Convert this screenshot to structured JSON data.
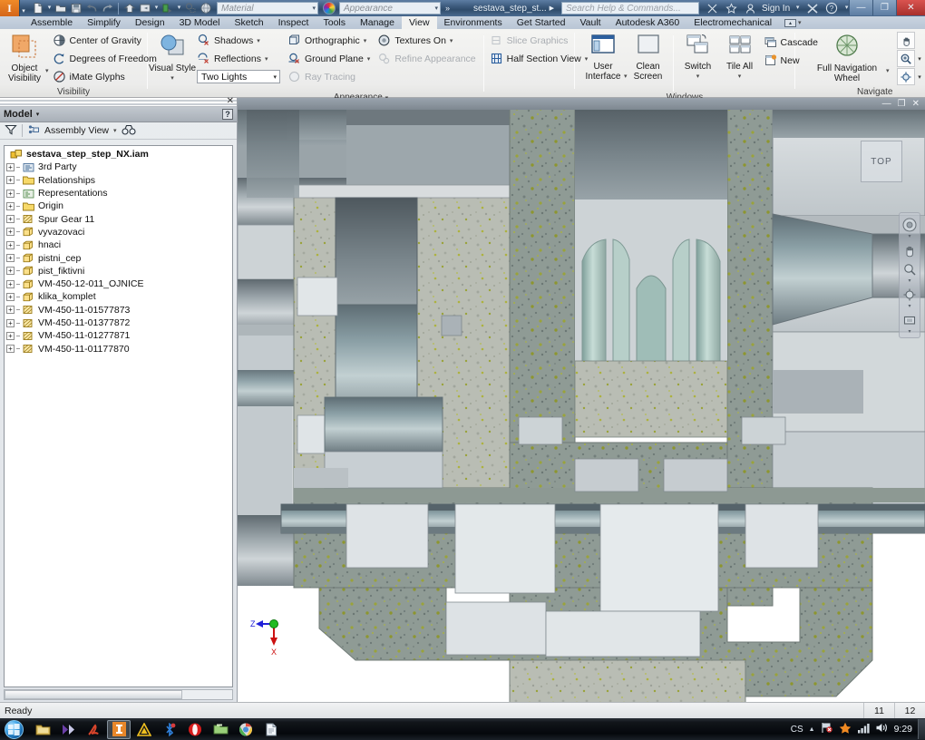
{
  "titlebar": {
    "app_icon": "inventor-logo-icon",
    "quick_access": [
      {
        "name": "new-document",
        "icon": "new-file-icon",
        "dropdown": true
      },
      {
        "name": "open-document",
        "icon": "open-folder-icon",
        "dropdown": false
      },
      {
        "name": "save-document",
        "icon": "save-disk-icon",
        "dropdown": false
      },
      {
        "name": "undo",
        "icon": "undo-arrow-icon",
        "dropdown": false
      },
      {
        "name": "redo",
        "icon": "redo-arrow-icon",
        "dropdown": false
      },
      {
        "name": "home",
        "icon": "home-icon",
        "dropdown": false
      },
      {
        "name": "return",
        "icon": "return-icon",
        "dropdown": true
      },
      {
        "name": "update",
        "icon": "update-icon",
        "dropdown": true
      },
      {
        "name": "select",
        "icon": "select-icon",
        "dropdown": false
      },
      {
        "name": "appearance-sphere",
        "icon": "sphere-icon",
        "dropdown": false
      }
    ],
    "material_value": "",
    "material_placeholder": "Material",
    "appearance_value": "",
    "appearance_placeholder": "Appearance",
    "overflow": "»",
    "document_tab": "sestava_step_st...",
    "search_placeholder": "Search Help & Commands...",
    "sign_in": "Sign In",
    "window_buttons": {
      "minimize": "—",
      "restore": "❐",
      "close": "✕"
    }
  },
  "ribbon_tabs": {
    "items": [
      {
        "label": "Assemble",
        "active": false
      },
      {
        "label": "Simplify",
        "active": false
      },
      {
        "label": "Design",
        "active": false
      },
      {
        "label": "3D Model",
        "active": false
      },
      {
        "label": "Sketch",
        "active": false
      },
      {
        "label": "Inspect",
        "active": false
      },
      {
        "label": "Tools",
        "active": false
      },
      {
        "label": "Manage",
        "active": false
      },
      {
        "label": "View",
        "active": true
      },
      {
        "label": "Environments",
        "active": false
      },
      {
        "label": "Get Started",
        "active": false
      },
      {
        "label": "Vault",
        "active": false
      },
      {
        "label": "Autodesk A360",
        "active": false
      },
      {
        "label": "Electromechanical",
        "active": false
      }
    ]
  },
  "ribbon": {
    "visibility": {
      "title": "Visibility",
      "object_visibility": {
        "line1": "Object",
        "line2": "Visibility",
        "icon": "object-visibility-icon"
      },
      "items": [
        {
          "label": "Center of Gravity",
          "icon": "center-of-gravity-icon",
          "disabled": false
        },
        {
          "label": "Degrees of Freedom",
          "icon": "degrees-of-freedom-icon",
          "disabled": false
        },
        {
          "label": "iMate Glyphs",
          "icon": "imate-glyphs-icon",
          "disabled": false
        }
      ]
    },
    "appearance": {
      "title": "Appearance",
      "visual_style": {
        "line1": "Visual Style",
        "icon": "visual-style-icon"
      },
      "col1": [
        {
          "label": "Shadows",
          "icon": "shadows-icon",
          "caret": true,
          "disabled": false
        },
        {
          "label": "Reflections",
          "icon": "reflections-icon",
          "caret": true,
          "disabled": false
        }
      ],
      "lights_value": "Two Lights",
      "col2": [
        {
          "label": "Orthographic",
          "icon": "orthographic-icon",
          "caret": true,
          "disabled": false
        },
        {
          "label": "Ground Plane",
          "icon": "ground-plane-icon",
          "caret": true,
          "disabled": false
        },
        {
          "label": "Ray Tracing",
          "icon": "ray-tracing-icon",
          "caret": false,
          "disabled": true
        }
      ],
      "col3": [
        {
          "label": "Textures On",
          "icon": "textures-on-icon",
          "caret": true,
          "disabled": false
        },
        {
          "label": "Refine Appearance",
          "icon": "refine-appearance-icon",
          "caret": false,
          "disabled": true
        }
      ],
      "col4": [
        {
          "label": "Slice Graphics",
          "icon": "slice-graphics-icon",
          "caret": false,
          "disabled": true
        },
        {
          "label": "Half Section View",
          "icon": "half-section-view-icon",
          "caret": true,
          "disabled": false
        }
      ]
    },
    "windows": {
      "title": "Windows",
      "big": [
        {
          "line1": "User",
          "line2": "Interface",
          "icon": "user-interface-icon",
          "caret": true
        },
        {
          "line1": "Clean",
          "line2": "Screen",
          "icon": "clean-screen-icon",
          "caret": false
        },
        {
          "line1": "Switch",
          "line2": "",
          "icon": "switch-windows-icon",
          "caret": true
        },
        {
          "line1": "Tile All",
          "line2": "",
          "icon": "tile-all-icon",
          "caret": true
        }
      ],
      "small": [
        {
          "label": "Cascade",
          "icon": "cascade-icon"
        },
        {
          "label": "New",
          "icon": "new-window-icon"
        }
      ]
    },
    "navigate": {
      "title": "Navigate",
      "wheel": {
        "line1": "Full Navigation",
        "line2": "Wheel",
        "icon": "navigation-wheel-icon",
        "caret": true
      },
      "buttons": [
        {
          "name": "pan-icon",
          "caret": false
        },
        {
          "name": "camera-icon",
          "caret": false
        },
        {
          "name": "zoom-icon",
          "caret": true
        },
        {
          "name": "zoom-extents-icon",
          "caret": true
        },
        {
          "name": "orbit-icon",
          "caret": true
        },
        {
          "name": "home-view-icon",
          "caret": false
        }
      ]
    }
  },
  "browser": {
    "close_label": "✕",
    "panel_title": "Model",
    "help_label": "?",
    "filter_icon": "filter-funnel-icon",
    "view_label": "Assembly View",
    "view_icon": "assembly-view-icon",
    "find_icon": "binoculars-icon",
    "root": {
      "label": "sestava_step_step_NX.iam",
      "icon": "assembly-icon"
    },
    "nodes": [
      {
        "label": "3rd Party",
        "icon": "third-party-icon",
        "expandable": true
      },
      {
        "label": "Relationships",
        "icon": "folder-icon",
        "expandable": true
      },
      {
        "label": "Representations",
        "icon": "representations-icon",
        "expandable": true
      },
      {
        "label": "Origin",
        "icon": "folder-icon",
        "expandable": true
      },
      {
        "label": "Spur Gear 11",
        "icon": "gear-part-icon",
        "expandable": true
      },
      {
        "label": "vyvazovaci",
        "icon": "part-cube-icon",
        "expandable": true
      },
      {
        "label": "hnaci",
        "icon": "part-cube-icon",
        "expandable": true
      },
      {
        "label": "pistni_cep",
        "icon": "part-cube-icon",
        "expandable": true
      },
      {
        "label": "pist_fiktivni",
        "icon": "part-cube-icon",
        "expandable": true
      },
      {
        "label": "VM-450-12-011_OJNICE",
        "icon": "part-cube-icon",
        "expandable": true
      },
      {
        "label": "klika_komplet",
        "icon": "part-cube-icon",
        "expandable": true
      },
      {
        "label": "VM-450-11-01577873",
        "icon": "gear-part-icon",
        "expandable": true
      },
      {
        "label": "VM-450-11-01377872",
        "icon": "gear-part-icon",
        "expandable": true
      },
      {
        "label": "VM-450-11-01277871",
        "icon": "gear-part-icon",
        "expandable": true
      },
      {
        "label": "VM-450-11-01177870",
        "icon": "gear-part-icon",
        "expandable": true
      }
    ]
  },
  "viewport": {
    "window_buttons": {
      "minimize": "—",
      "restore": "❐",
      "close": "✕"
    },
    "viewcube_face": "TOP",
    "axis": {
      "z_label": "Z",
      "x_label": "X",
      "z_color": "#2020d8",
      "x_color": "#cc1111",
      "origin_color": "#22bb22"
    },
    "navbar_buttons": [
      {
        "name": "steering-wheel-icon"
      },
      {
        "name": "pan-hand-icon"
      },
      {
        "name": "zoom-nav-icon"
      },
      {
        "name": "orbit-nav-icon"
      },
      {
        "name": "look-at-icon"
      }
    ],
    "colors": {
      "background": "#ffffff",
      "cast_iron": "#8e9a93",
      "steel_light": "#c9ced2",
      "steel_dark": "#6f7a80",
      "teal": "#8fada8",
      "speckle": "#9aa33a"
    }
  },
  "statusbar": {
    "message": "Ready",
    "cells": [
      "11",
      "12"
    ]
  },
  "taskbar": {
    "start": "start-orb-icon",
    "items": [
      {
        "name": "explorer-icon",
        "active": false
      },
      {
        "name": "media-player-icon",
        "active": false
      },
      {
        "name": "pdf-reader-icon",
        "active": false
      },
      {
        "name": "inventor-icon",
        "active": true
      },
      {
        "name": "autocad-icon",
        "active": false
      },
      {
        "name": "bluetooth-icon",
        "active": false
      },
      {
        "name": "opera-icon",
        "active": false
      },
      {
        "name": "folder-app-icon",
        "active": false
      },
      {
        "name": "chrome-icon",
        "active": false
      },
      {
        "name": "document-icon",
        "active": false
      }
    ],
    "tray": {
      "language": "CS",
      "chevron": "▲",
      "icons": [
        "network-flag-icon",
        "avast-icon",
        "signal-bars-icon",
        "volume-icon"
      ],
      "clock": "9:29"
    }
  }
}
